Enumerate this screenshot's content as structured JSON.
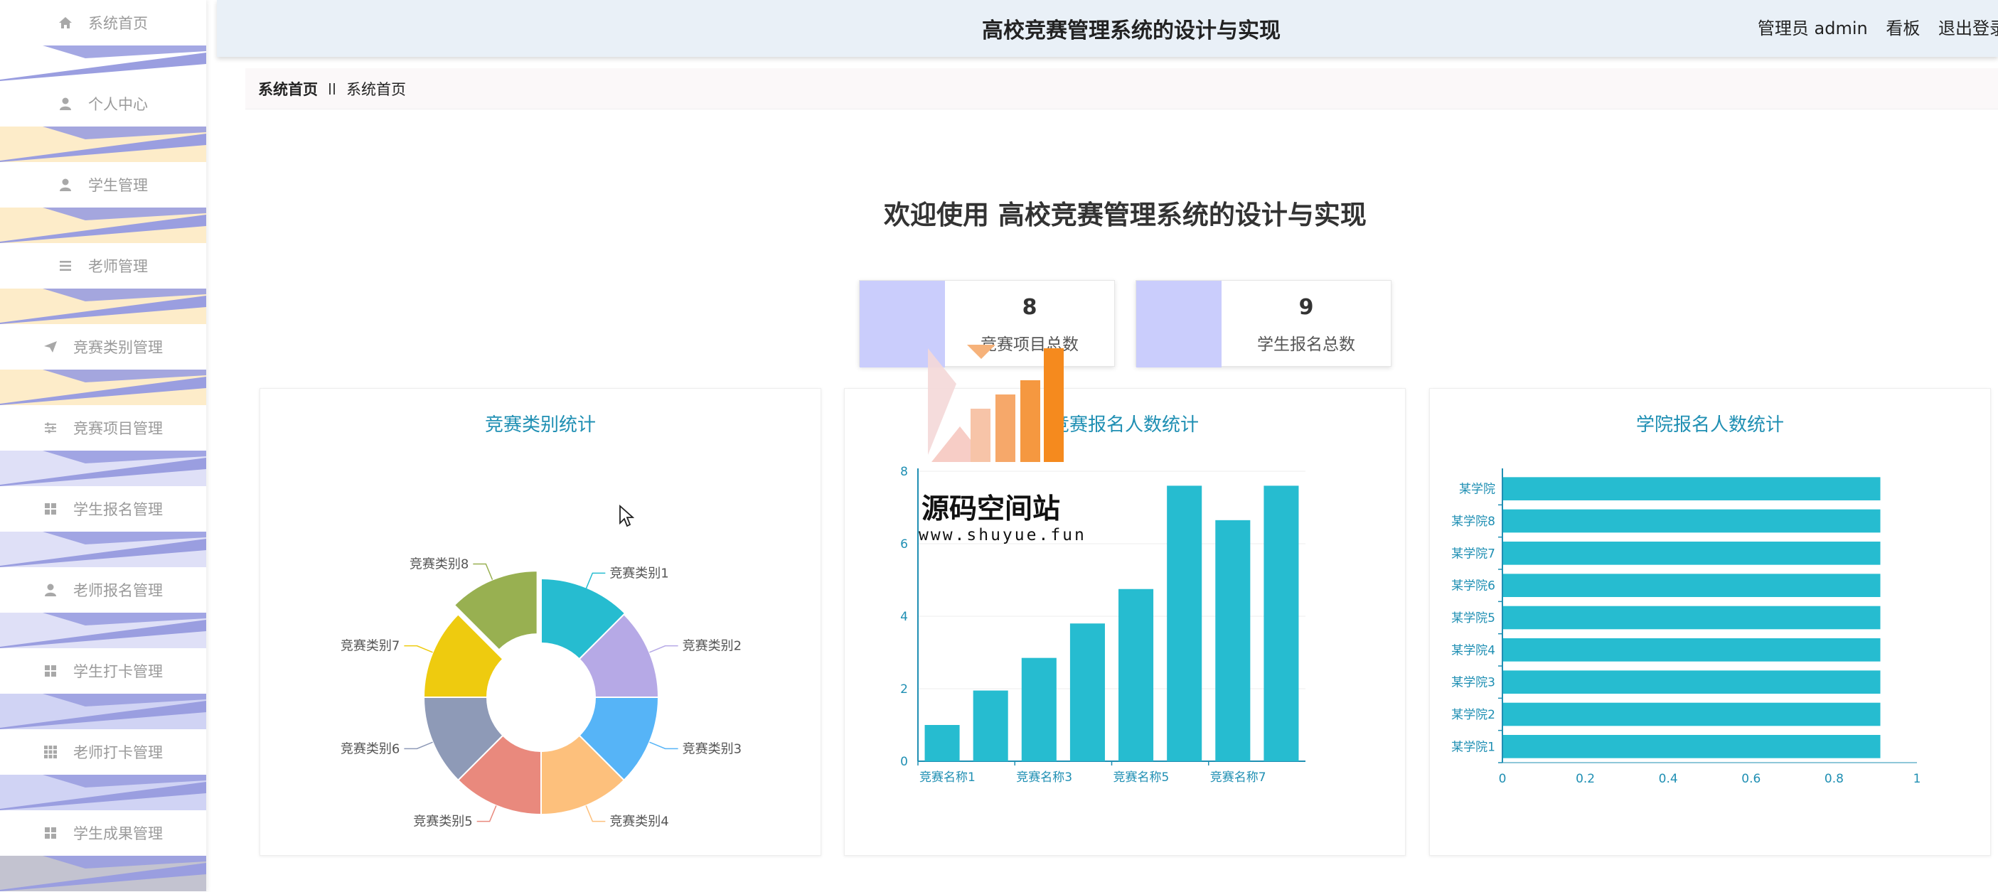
{
  "header": {
    "title": "高校竞赛管理系统的设计与实现",
    "role": "管理员 admin",
    "board_link": "看板",
    "logout_link": "退出登录"
  },
  "sidebar": {
    "items": [
      {
        "label": "系统首页",
        "icon": "home-icon"
      },
      {
        "label": "个人中心",
        "icon": "user-icon"
      },
      {
        "label": "学生管理",
        "icon": "student-icon"
      },
      {
        "label": "老师管理",
        "icon": "list-icon"
      },
      {
        "label": "竞赛类别管理",
        "icon": "send-icon"
      },
      {
        "label": "竞赛项目管理",
        "icon": "sliders-icon"
      },
      {
        "label": "学生报名管理",
        "icon": "grid-icon"
      },
      {
        "label": "老师报名管理",
        "icon": "user-icon"
      },
      {
        "label": "学生打卡管理",
        "icon": "grid-icon"
      },
      {
        "label": "老师打卡管理",
        "icon": "grid9-icon"
      },
      {
        "label": "学生成果管理",
        "icon": "grid-icon"
      }
    ]
  },
  "breadcrumb": {
    "home": "系统首页",
    "current": "系统首页"
  },
  "welcome": "欢迎使用 高校竞赛管理系统的设计与实现",
  "stats": [
    {
      "value": "8",
      "label": "竞赛项目总数"
    },
    {
      "value": "9",
      "label": "学生报名总数"
    }
  ],
  "watermark": {
    "text": "源码空间站",
    "url": "www.shuyue.fun"
  },
  "colors": {
    "accent": "#1f8fb3",
    "bar": "#26bcd0",
    "stat_swatch": "#cacdfc",
    "header_bg": "#e9f0f7"
  },
  "chart_data": [
    {
      "type": "pie",
      "title": "竞赛类别统计",
      "categories": [
        "竞赛类别1",
        "竞赛类别2",
        "竞赛类别3",
        "竞赛类别4",
        "竞赛类别5",
        "竞赛类别6",
        "竞赛类别7",
        "竞赛类别8"
      ],
      "values": [
        1,
        1,
        1,
        1,
        1,
        1,
        1,
        1
      ],
      "colors": [
        "#26bcd0",
        "#b6a9e6",
        "#56b4f7",
        "#fdc07c",
        "#e9897d",
        "#8e9ab7",
        "#eecb0f",
        "#98b051"
      ]
    },
    {
      "type": "bar",
      "title": "竞赛报名人数统计",
      "categories": [
        "竞赛名称1",
        "竞赛名称2",
        "竞赛名称3",
        "竞赛名称4",
        "竞赛名称5",
        "竞赛名称6",
        "竞赛名称7",
        "竞赛名称8"
      ],
      "x_tick_labels": [
        "竞赛名称1",
        "竞赛名称3",
        "竞赛名称5",
        "竞赛名称7"
      ],
      "values": [
        1,
        1.95,
        2.85,
        3.8,
        4.75,
        7.6,
        6.65,
        7.6
      ],
      "ylim": [
        0,
        8
      ],
      "yticks": [
        0,
        2,
        4,
        6,
        8
      ],
      "grid": true
    },
    {
      "type": "bar",
      "orientation": "horizontal",
      "title": "学院报名人数统计",
      "categories": [
        "某学院1",
        "某学院2",
        "某学院3",
        "某学院4",
        "某学院5",
        "某学院6",
        "某学院7",
        "某学院8",
        "某学院"
      ],
      "values": [
        0.91,
        0.91,
        0.91,
        0.91,
        0.91,
        0.91,
        0.91,
        0.91,
        0.91
      ],
      "xlim": [
        0,
        1
      ],
      "xticks": [
        0,
        0.2,
        0.4,
        0.6,
        0.8,
        1
      ],
      "grid": false
    }
  ]
}
